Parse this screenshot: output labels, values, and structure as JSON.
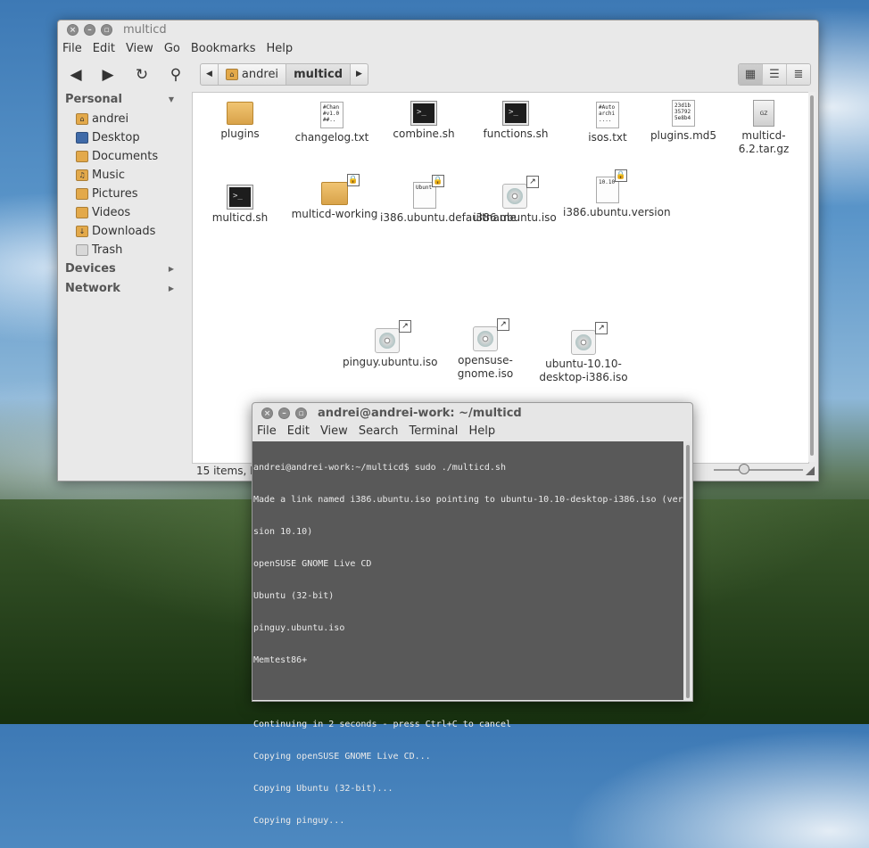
{
  "file_manager": {
    "title": "multicd",
    "menu": [
      "File",
      "Edit",
      "View",
      "Go",
      "Bookmarks",
      "Help"
    ],
    "path": {
      "home_segment": "andrei",
      "current_segment": "multicd"
    },
    "sidebar": {
      "personal_header": "Personal",
      "personal_items": [
        "andrei",
        "Desktop",
        "Documents",
        "Music",
        "Pictures",
        "Videos",
        "Downloads",
        "Trash"
      ],
      "devices_header": "Devices",
      "network_header": "Network"
    },
    "files": [
      {
        "name": "plugins",
        "kind": "folder",
        "emblem": ""
      },
      {
        "name": "changelog.txt",
        "kind": "text",
        "preview": "#Chan\n#v1.0\n##..",
        "emblem": ""
      },
      {
        "name": "combine.sh",
        "kind": "script",
        "emblem": ""
      },
      {
        "name": "functions.sh",
        "kind": "script",
        "emblem": ""
      },
      {
        "name": "isos.txt",
        "kind": "text",
        "preview": "#Auto\narchi\n....",
        "emblem": ""
      },
      {
        "name": "plugins.md5",
        "kind": "text",
        "preview": "23d1b\n35792\n5e8b4",
        "emblem": ""
      },
      {
        "name": "multicd-6.2.tar.gz",
        "kind": "archive",
        "emblem": ""
      },
      {
        "name": "multicd.sh",
        "kind": "script",
        "emblem": ""
      },
      {
        "name": "multicd-working",
        "kind": "folder",
        "emblem": "lock"
      },
      {
        "name": "i386.ubuntu.defaultname",
        "kind": "text",
        "preview": "Ubunt",
        "emblem": "lock"
      },
      {
        "name": "i386.ubuntu.iso",
        "kind": "disc",
        "emblem": "link"
      },
      {
        "name": "i386.ubuntu.version",
        "kind": "text",
        "preview": "10.10",
        "emblem": "lock"
      },
      {
        "name": "pinguy.ubuntu.iso",
        "kind": "disc",
        "emblem": "link"
      },
      {
        "name": "opensuse-gnome.iso",
        "kind": "disc",
        "emblem": "link"
      },
      {
        "name": "ubuntu-10.10-desktop-i386.iso",
        "kind": "disc",
        "emblem": "link"
      }
    ],
    "status": "15 items, Fr"
  },
  "terminal": {
    "title": "andrei@andrei-work: ~/multicd",
    "menu": [
      "File",
      "Edit",
      "View",
      "Search",
      "Terminal",
      "Help"
    ],
    "lines": [
      "andrei@andrei-work:~/multicd$ sudo ./multicd.sh",
      "Made a link named i386.ubuntu.iso pointing to ubuntu-10.10-desktop-i386.iso (ver",
      "sion 10.10)",
      "openSUSE GNOME Live CD",
      "Ubuntu (32-bit)",
      "pinguy.ubuntu.iso",
      "Memtest86+",
      "",
      "Continuing in 2 seconds - press Ctrl+C to cancel",
      "Copying openSUSE GNOME Live CD...",
      "Copying Ubuntu (32-bit)...",
      "Copying pinguy..."
    ]
  }
}
